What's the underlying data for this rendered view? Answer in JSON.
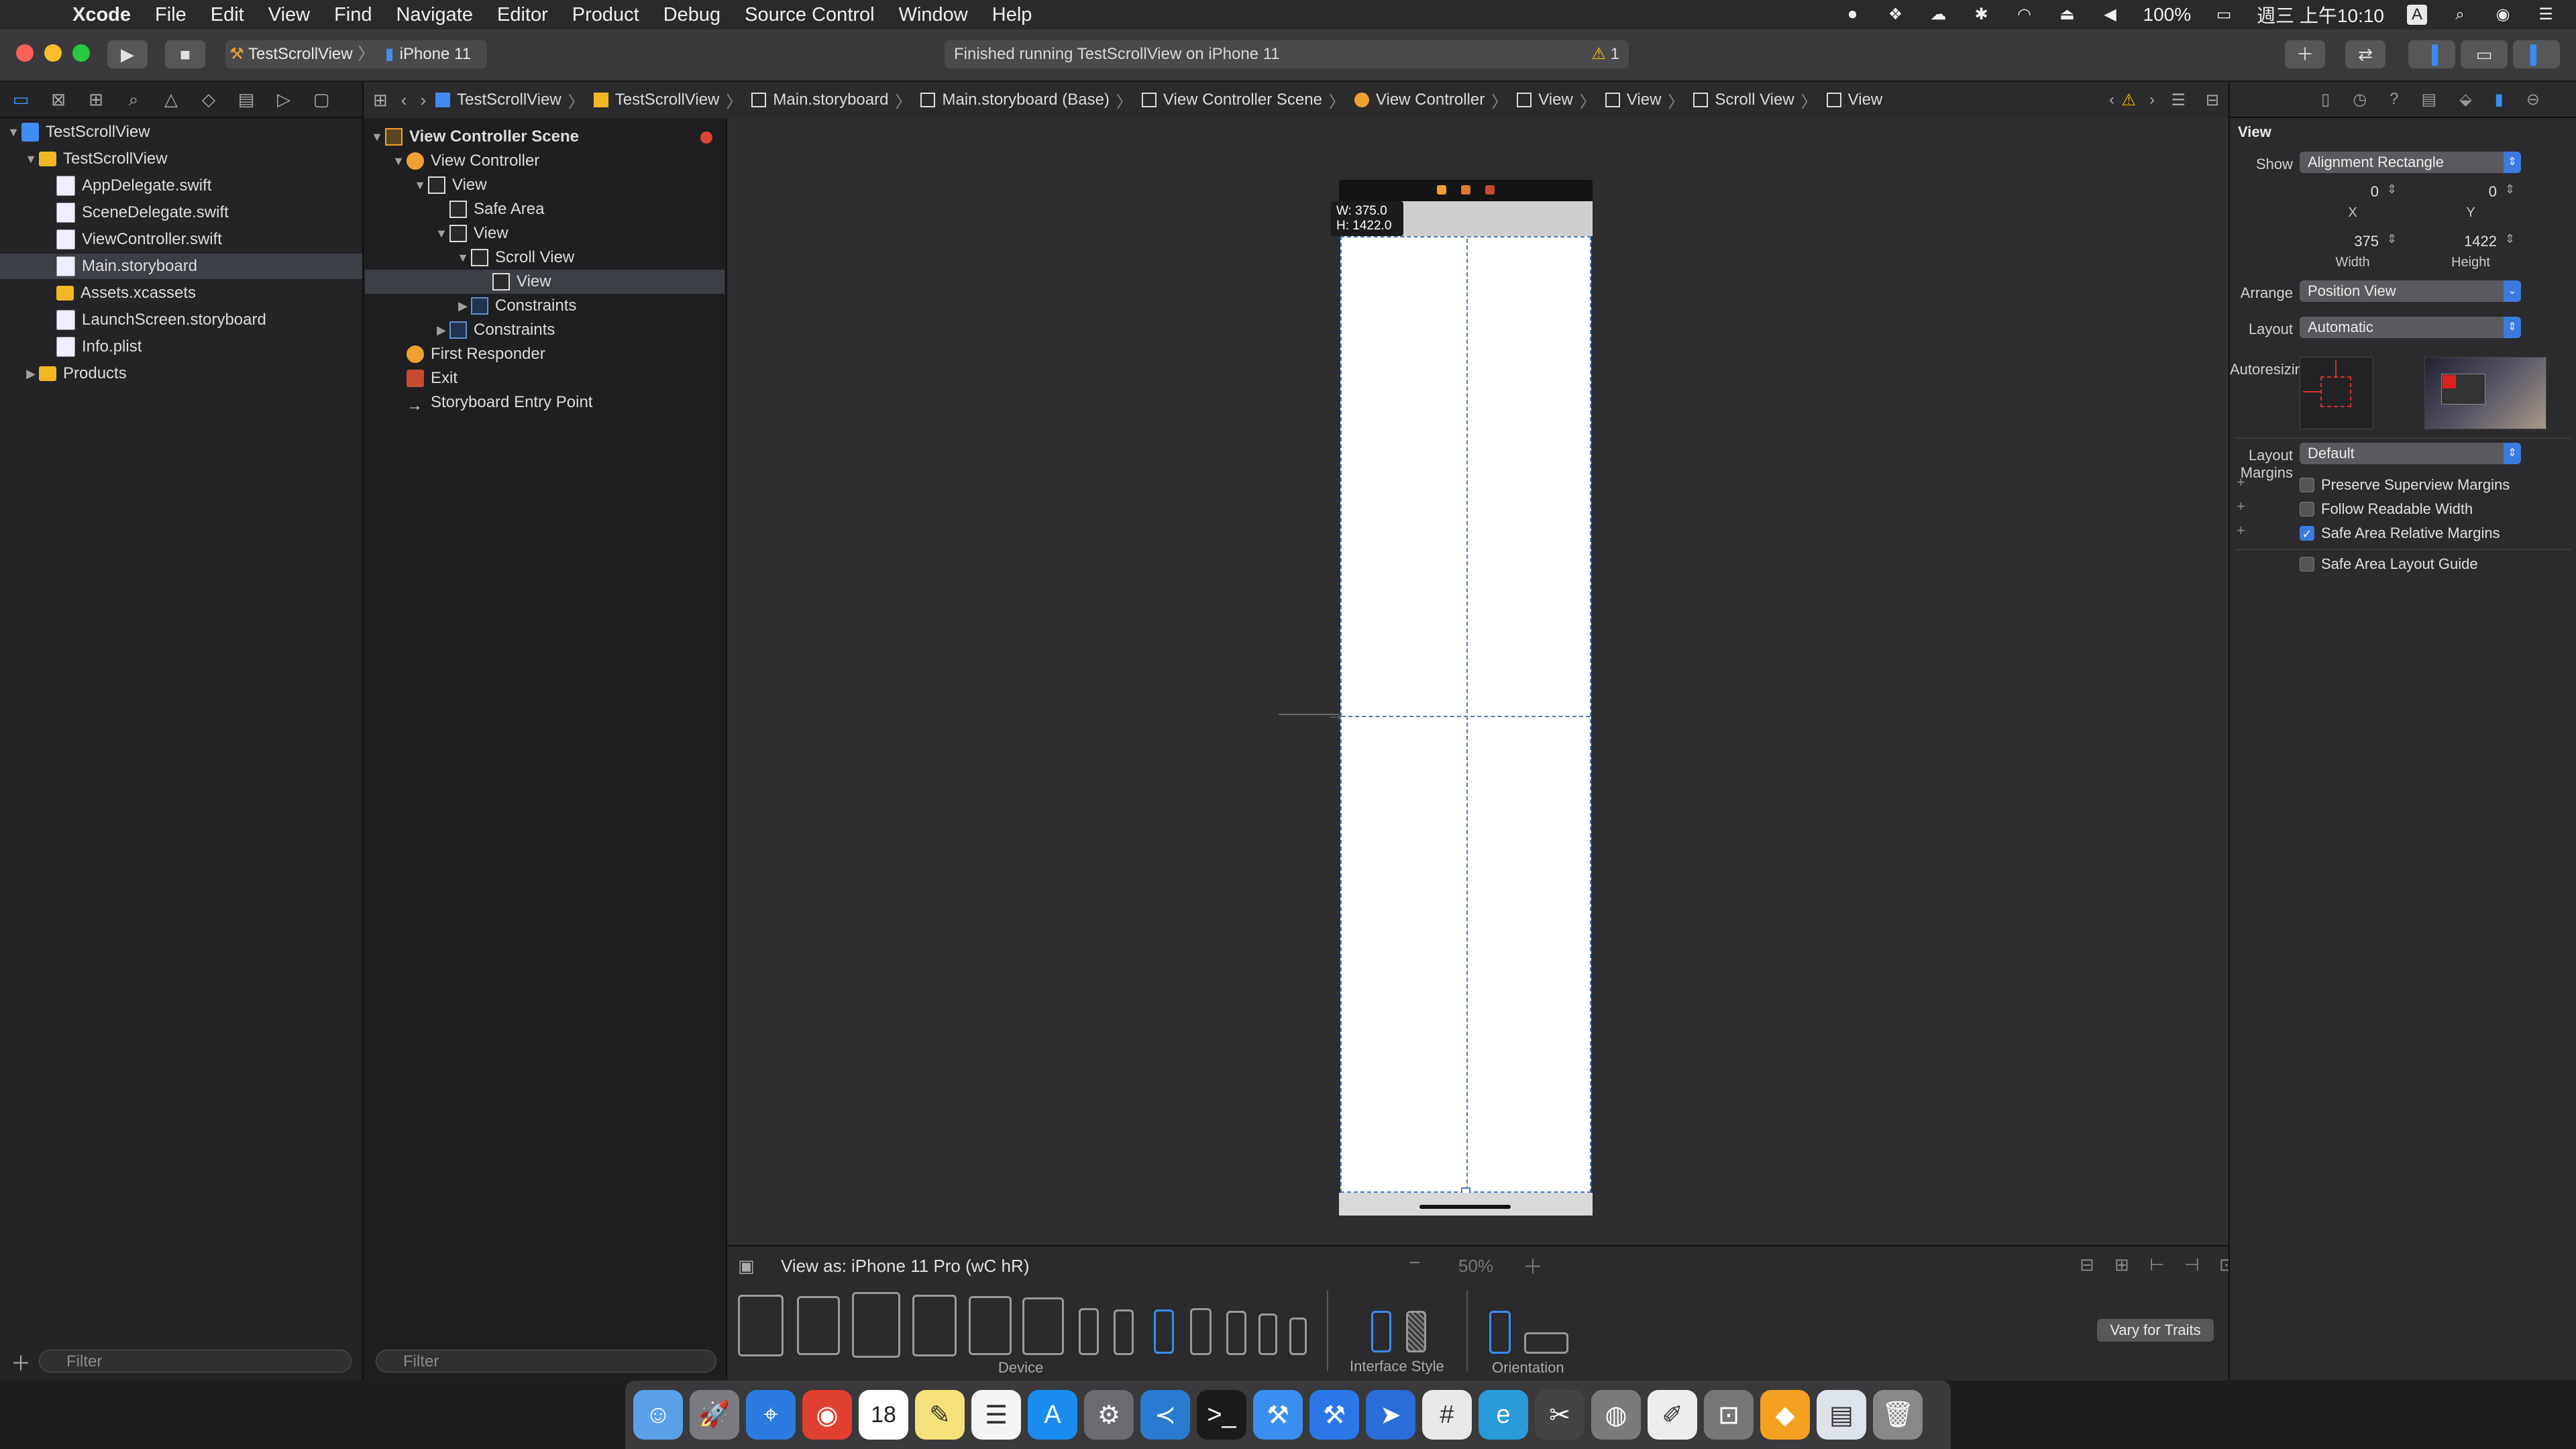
{
  "menubar": {
    "app": "Xcode",
    "items": [
      "File",
      "Edit",
      "View",
      "Find",
      "Navigate",
      "Editor",
      "Product",
      "Debug",
      "Source Control",
      "Window",
      "Help"
    ],
    "battery": "100%",
    "clock": "週三 上午10:10",
    "input_method": "A"
  },
  "toolbar": {
    "scheme": "TestScrollView",
    "device": "iPhone 11",
    "activity": "Finished running TestScrollView on iPhone 11",
    "warning_count": "1"
  },
  "navigator": {
    "items": [
      {
        "label": "TestScrollView",
        "kind": "project",
        "depth": 0,
        "disc": "▼"
      },
      {
        "label": "TestScrollView",
        "kind": "folder",
        "depth": 1,
        "disc": "▼"
      },
      {
        "label": "AppDelegate.swift",
        "kind": "doc",
        "depth": 2,
        "disc": ""
      },
      {
        "label": "SceneDelegate.swift",
        "kind": "doc",
        "depth": 2,
        "disc": ""
      },
      {
        "label": "ViewController.swift",
        "kind": "doc",
        "depth": 2,
        "disc": ""
      },
      {
        "label": "Main.storyboard",
        "kind": "doc",
        "depth": 2,
        "disc": "",
        "selected": true
      },
      {
        "label": "Assets.xcassets",
        "kind": "folder",
        "depth": 2,
        "disc": ""
      },
      {
        "label": "LaunchScreen.storyboard",
        "kind": "doc",
        "depth": 2,
        "disc": ""
      },
      {
        "label": "Info.plist",
        "kind": "doc",
        "depth": 2,
        "disc": ""
      },
      {
        "label": "Products",
        "kind": "folder",
        "depth": 1,
        "disc": "▶"
      }
    ],
    "filter_placeholder": "Filter"
  },
  "outline": {
    "items": [
      {
        "label": "View Controller Scene",
        "depth": 0,
        "disc": "▼",
        "icon": "scene"
      },
      {
        "label": "View Controller",
        "depth": 1,
        "disc": "▼",
        "icon": "vc"
      },
      {
        "label": "View",
        "depth": 2,
        "disc": "▼",
        "icon": "view"
      },
      {
        "label": "Safe Area",
        "depth": 3,
        "disc": "",
        "icon": "view"
      },
      {
        "label": "View",
        "depth": 3,
        "disc": "▼",
        "icon": "view"
      },
      {
        "label": "Scroll View",
        "depth": 4,
        "disc": "▼",
        "icon": "view"
      },
      {
        "label": "View",
        "depth": 5,
        "disc": "",
        "icon": "view",
        "selected": true
      },
      {
        "label": "Constraints",
        "depth": 4,
        "disc": "▶",
        "icon": "cons"
      },
      {
        "label": "Constraints",
        "depth": 3,
        "disc": "▶",
        "icon": "cons"
      },
      {
        "label": "First Responder",
        "depth": 1,
        "disc": "",
        "icon": "fr"
      },
      {
        "label": "Exit",
        "depth": 1,
        "disc": "",
        "icon": "exit"
      },
      {
        "label": "Storyboard Entry Point",
        "depth": 1,
        "disc": "",
        "icon": "arrow"
      }
    ],
    "filter_placeholder": "Filter"
  },
  "jumpbar": {
    "crumbs": [
      "TestScrollView",
      "TestScrollView",
      "Main.storyboard",
      "Main.storyboard (Base)",
      "View Controller Scene",
      "View Controller",
      "View",
      "View",
      "Scroll View",
      "View"
    ]
  },
  "canvas": {
    "size_w": "W:  375.0",
    "size_h": "H:  1422.0"
  },
  "bottom": {
    "view_as": "View as: iPhone 11 Pro (wC hR)",
    "zoom": "50%",
    "device_label": "Device",
    "interface_style_label": "Interface Style",
    "orientation_label": "Orientation",
    "vary_button": "Vary for Traits"
  },
  "inspector": {
    "title": "View",
    "show_label": "Show",
    "show_value": "Alignment Rectangle",
    "x_value": "0",
    "y_value": "0",
    "x_label": "X",
    "y_label": "Y",
    "width_value": "375",
    "height_value": "1422",
    "width_label": "Width",
    "height_label": "Height",
    "arrange_label": "Arrange",
    "arrange_value": "Position View",
    "layout_label": "Layout",
    "layout_value": "Automatic",
    "autoresizing_label": "Autoresizing",
    "margins_label": "Layout Margins",
    "margins_value": "Default",
    "check_preserve": "Preserve Superview Margins",
    "check_readable": "Follow Readable Width",
    "check_safearea": "Safe Area Relative Margins",
    "check_guide": "Safe Area Layout Guide"
  },
  "dock": {
    "apps": [
      "finder-icon",
      "launchpad-icon",
      "safari-icon",
      "chrome-icon",
      "calendar-icon",
      "notes-icon",
      "reminders-icon",
      "app-store-icon",
      "system-preferences-icon",
      "vscode-icon",
      "terminal-icon",
      "xcode-icon",
      "xcode-beta-icon",
      "maps-icon",
      "slack-icon",
      "edge-icon",
      "final-cut-icon",
      "instruments-icon",
      "textedit-icon",
      "archive-icon",
      "sketch-icon",
      "preview-icon",
      "trash-icon"
    ],
    "calendar_day": "18"
  },
  "colors": {
    "accent": "#3b8cf0",
    "warning": "#f5c400",
    "selection": "#3c3f46"
  }
}
